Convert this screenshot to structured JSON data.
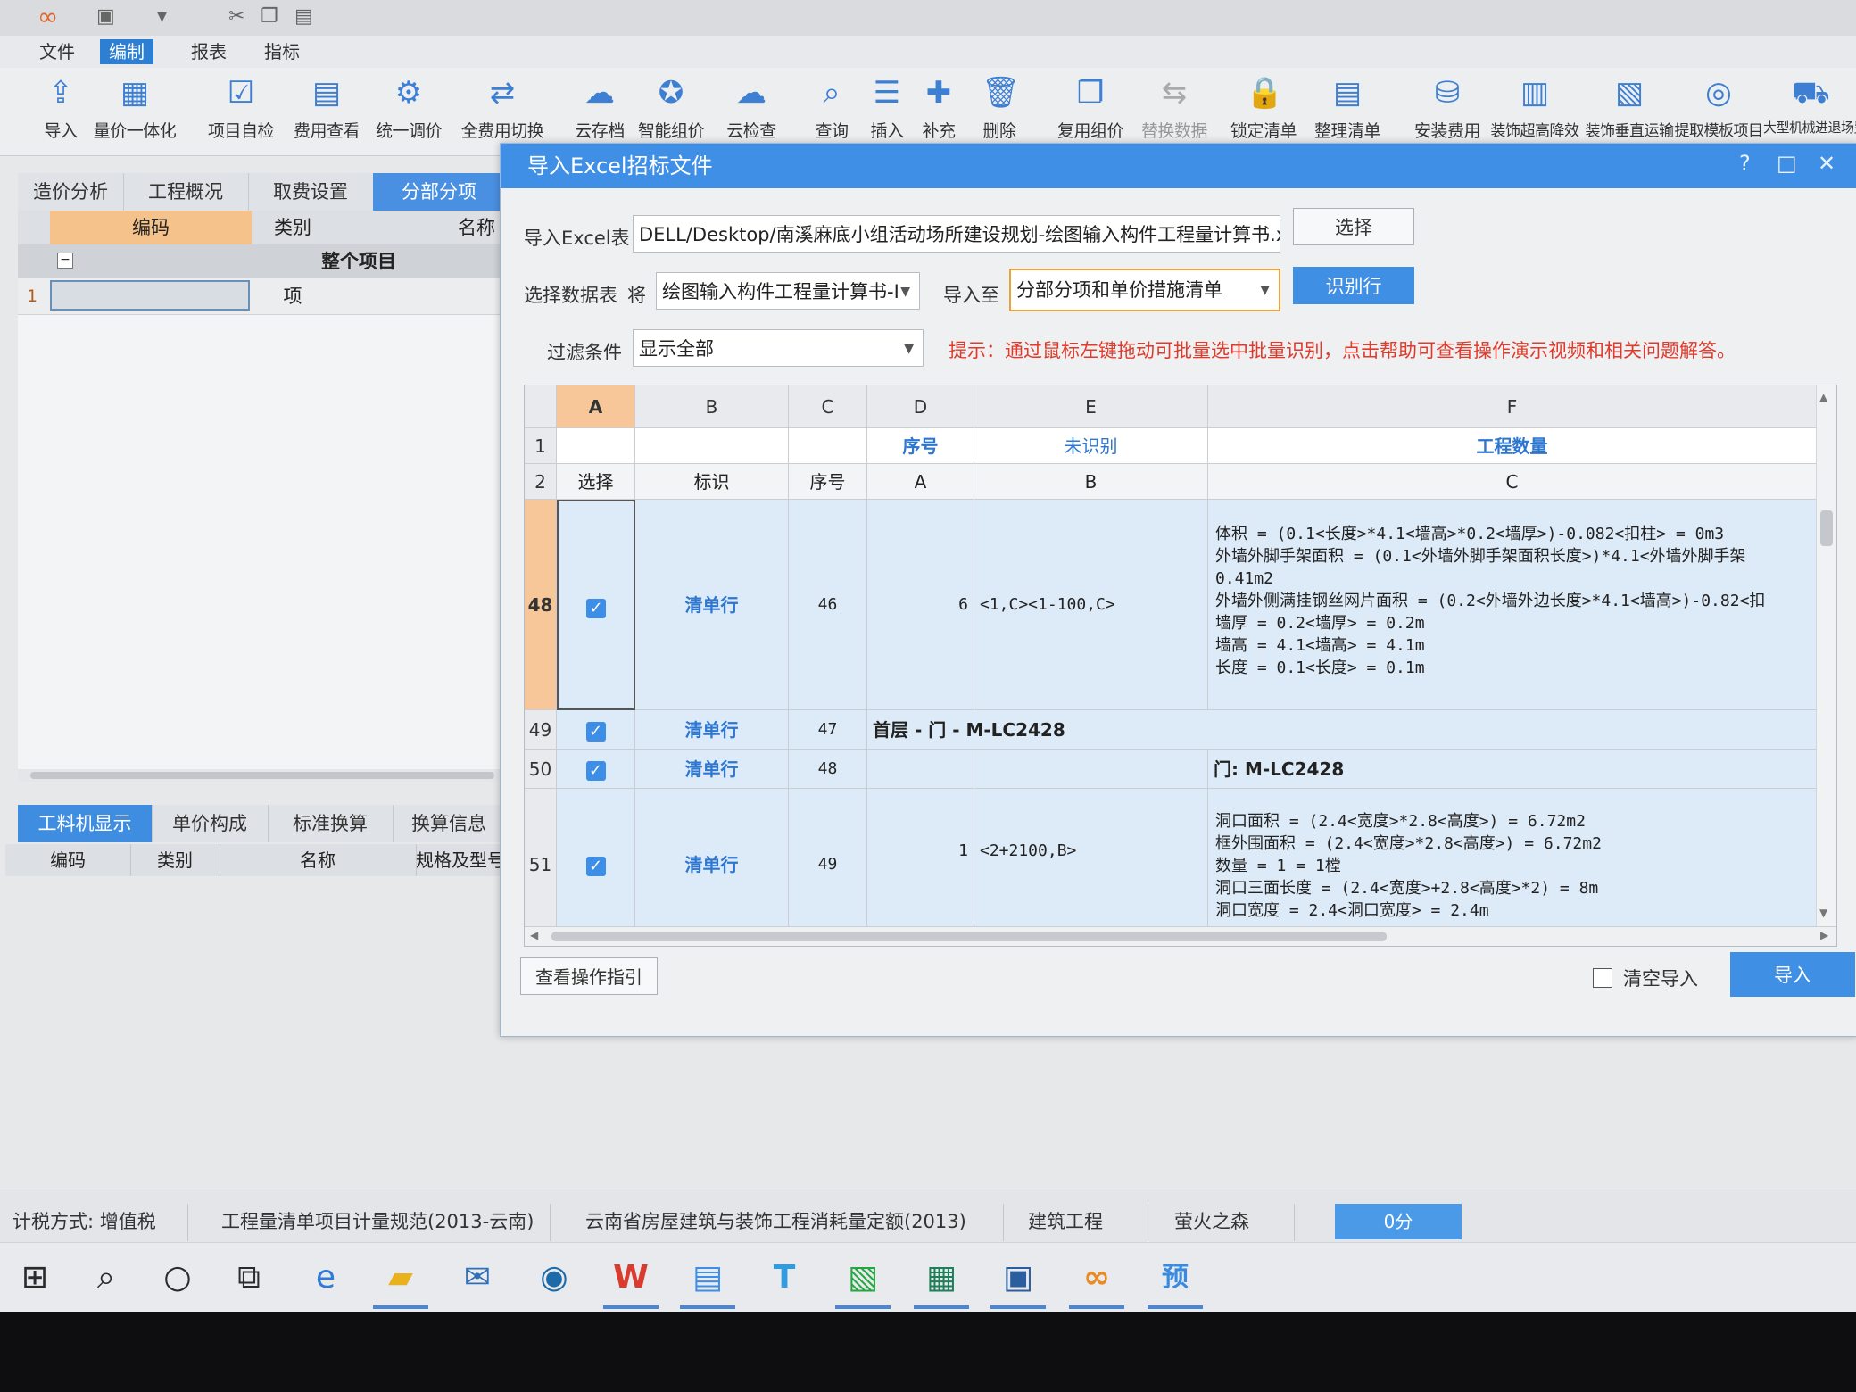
{
  "titlebar": {
    "icons": [
      "logo-icon",
      "save-icon",
      "undo-icon",
      "cut-icon",
      "copy-icon",
      "paste-icon"
    ]
  },
  "menu": {
    "items": [
      "文件",
      "编制",
      "报表",
      "指标"
    ]
  },
  "ribbon": [
    {
      "label": "导入",
      "icon": "⇪"
    },
    {
      "label": "量价一体化",
      "icon": "▦"
    },
    {
      "label": "项目自检",
      "icon": "☑"
    },
    {
      "label": "费用查看",
      "icon": "▤"
    },
    {
      "label": "统一调价",
      "icon": "⚙"
    },
    {
      "label": "全费用切换",
      "icon": "⇄"
    },
    {
      "label": "云存档",
      "icon": "☁"
    },
    {
      "label": "智能组价",
      "icon": "✪"
    },
    {
      "label": "云检查",
      "icon": "☁"
    },
    {
      "label": "查询",
      "icon": "⌕"
    },
    {
      "label": "插入",
      "icon": "☰"
    },
    {
      "label": "补充",
      "icon": "✚"
    },
    {
      "label": "删除",
      "icon": "🗑"
    },
    {
      "label": "复用组价",
      "icon": "❐"
    },
    {
      "label": "替换数据",
      "icon": "⇆"
    },
    {
      "label": "锁定清单",
      "icon": "🔒"
    },
    {
      "label": "整理清单",
      "icon": "▤"
    },
    {
      "label": "安装费用",
      "icon": "⛁"
    },
    {
      "label": "装饰超高降效",
      "icon": "▥"
    },
    {
      "label": "装饰垂直运输",
      "icon": "▧"
    },
    {
      "label": "提取模板项目",
      "icon": "◎"
    },
    {
      "label": "大型机械进退场费",
      "icon": "⛟"
    }
  ],
  "left_panel": {
    "tabs": [
      "造价分析",
      "工程概况",
      "取费设置",
      "分部分项"
    ],
    "headers": [
      "编码",
      "类别",
      "名称"
    ],
    "group_row": "整个项目",
    "row1_num": "1",
    "row1_type": "项"
  },
  "bottom_panel": {
    "tabs": [
      "工料机显示",
      "单价构成",
      "标准换算",
      "换算信息"
    ],
    "headers": [
      "编码",
      "类别",
      "名称",
      "规格及型号"
    ]
  },
  "dialog": {
    "title": "导入Excel招标文件",
    "excel_label": "导入Excel表",
    "excel_path": "DELL/Desktop/南溪麻底小组活动场所建设规划-绘图输入构件工程量计算书.xls",
    "choose_btn": "选择",
    "sheet_label": "选择数据表",
    "sheet_prefix": "将",
    "sheet_value": "绘图输入构件工程量计算书-I",
    "import_to_label": "导入至",
    "import_to_value": "分部分项和单价措施清单",
    "identify_btn": "识别行",
    "filter_label": "过滤条件",
    "filter_value": "显示全部",
    "hint": "提示：通过鼠标左键拖动可批量选中批量识别，点击帮助可查看操作演示视频和相关问题解答。",
    "guide_btn": "查看操作指引",
    "clear_import": "清空导入",
    "import_btn": "导入",
    "grid": {
      "col_letters": [
        "A",
        "B",
        "C",
        "D",
        "E",
        "F"
      ],
      "row1": {
        "num": "1",
        "d": "序号",
        "e": "未识别",
        "f": "工程数量"
      },
      "row2": {
        "num": "2",
        "a": "选择",
        "b": "标识",
        "c": "序号",
        "d": "A",
        "e": "B",
        "f": "C"
      },
      "rows": [
        {
          "num": "48",
          "mark": "清单行",
          "seq": "46",
          "d": "6",
          "e": "<1,C><1-100,C>",
          "lines": [
            "体积 = (0.1<长度>*4.1<墙高>*0.2<墙厚>)-0.082<扣柱> = 0m3",
            "外墙外脚手架面积 = (0.1<外墙外脚手架面积长度>)*4.1<外墙外脚手架",
            "0.41m2",
            "外墙外侧满挂钢丝网片面积 = (0.2<外墙外边长度>*4.1<墙高>)-0.82<扣",
            "墙厚 = 0.2<墙厚> = 0.2m",
            "墙高 = 4.1<墙高> = 4.1m",
            "长度 = 0.1<长度> = 0.1m"
          ]
        },
        {
          "num": "49",
          "mark": "清单行",
          "seq": "47",
          "span_text": "首层 - 门 - M-LC2428"
        },
        {
          "num": "50",
          "mark": "清单行",
          "seq": "48",
          "f": "门: M-LC2428"
        },
        {
          "num": "51",
          "mark": "清单行",
          "seq": "49",
          "d": "1",
          "e": "<2+2100,B>",
          "lines": [
            "洞口面积 = (2.4<宽度>*2.8<高度>) = 6.72m2",
            "框外围面积 = (2.4<宽度>*2.8<高度>) = 6.72m2",
            "数量 = 1 = 1樘",
            "洞口三面长度 = (2.4<宽度>+2.8<高度>*2) = 8m",
            "洞口宽度 = 2.4<洞口宽度> = 2.4m"
          ]
        }
      ]
    }
  },
  "status": {
    "tax": "计税方式: 增值税",
    "spec": "工程量清单项目计量规范(2013-云南)",
    "quota": "云南省房屋建筑与装饰工程消耗量定额(2013)",
    "type": "建筑工程",
    "user": "萤火之森",
    "score": "0分"
  },
  "taskbar": [
    {
      "name": "start-icon",
      "glyph": "⊞",
      "color": "#2b2b2b"
    },
    {
      "name": "search-icon",
      "glyph": "⌕",
      "color": "#2b2b2b"
    },
    {
      "name": "cortana-icon",
      "glyph": "○",
      "color": "#2b2b2b"
    },
    {
      "name": "task-view-icon",
      "glyph": "⧉",
      "color": "#2b2b2b"
    },
    {
      "name": "edge-icon",
      "glyph": "e",
      "color": "#2f7bd6"
    },
    {
      "name": "file-explorer-icon",
      "glyph": "▰",
      "color": "#e9b21c"
    },
    {
      "name": "mail-icon",
      "glyph": "✉",
      "color": "#2f6fb8"
    },
    {
      "name": "app-icon-1",
      "glyph": "◉",
      "color": "#1d6aa8"
    },
    {
      "name": "wps-icon",
      "glyph": "W",
      "color": "#d93b2e"
    },
    {
      "name": "app-icon-2",
      "glyph": "▤",
      "color": "#3d8ee6"
    },
    {
      "name": "app-icon-3",
      "glyph": "T",
      "color": "#2f9be0"
    },
    {
      "name": "app-icon-4",
      "glyph": "▧",
      "color": "#26a641"
    },
    {
      "name": "app-icon-5",
      "glyph": "▦",
      "color": "#1f7f5a"
    },
    {
      "name": "app-icon-6",
      "glyph": "▣",
      "color": "#2a5e9f"
    },
    {
      "name": "glodon-icon",
      "glyph": "∞",
      "color": "#e98a24"
    },
    {
      "name": "app-icon-7",
      "glyph": "预",
      "color": "#3a8be0"
    }
  ]
}
